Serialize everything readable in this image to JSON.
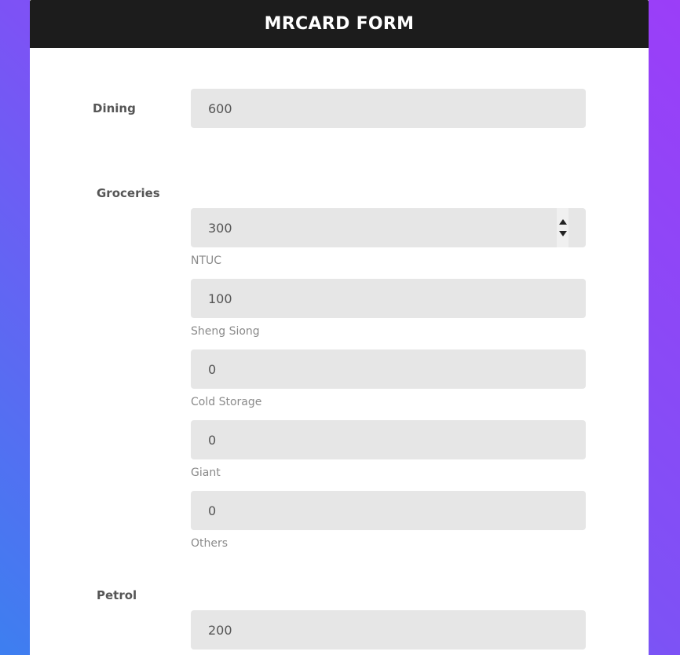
{
  "form": {
    "title": "MRCARD FORM"
  },
  "dining": {
    "label": "Dining",
    "value": "600"
  },
  "groceries": {
    "label": "Groceries",
    "items": [
      {
        "value": "300",
        "label": "NTUC"
      },
      {
        "value": "100",
        "label": "Sheng Siong"
      },
      {
        "value": "0",
        "label": "Cold Storage"
      },
      {
        "value": "0",
        "label": "Giant"
      },
      {
        "value": "0",
        "label": "Others"
      }
    ]
  },
  "petrol": {
    "label": "Petrol",
    "value": "200"
  },
  "colors": {
    "header_bg": "#1c1c1c",
    "field_bg": "#e6e6e6",
    "gradient_start": "#3d7ff0",
    "gradient_end": "#9b3ef8"
  }
}
